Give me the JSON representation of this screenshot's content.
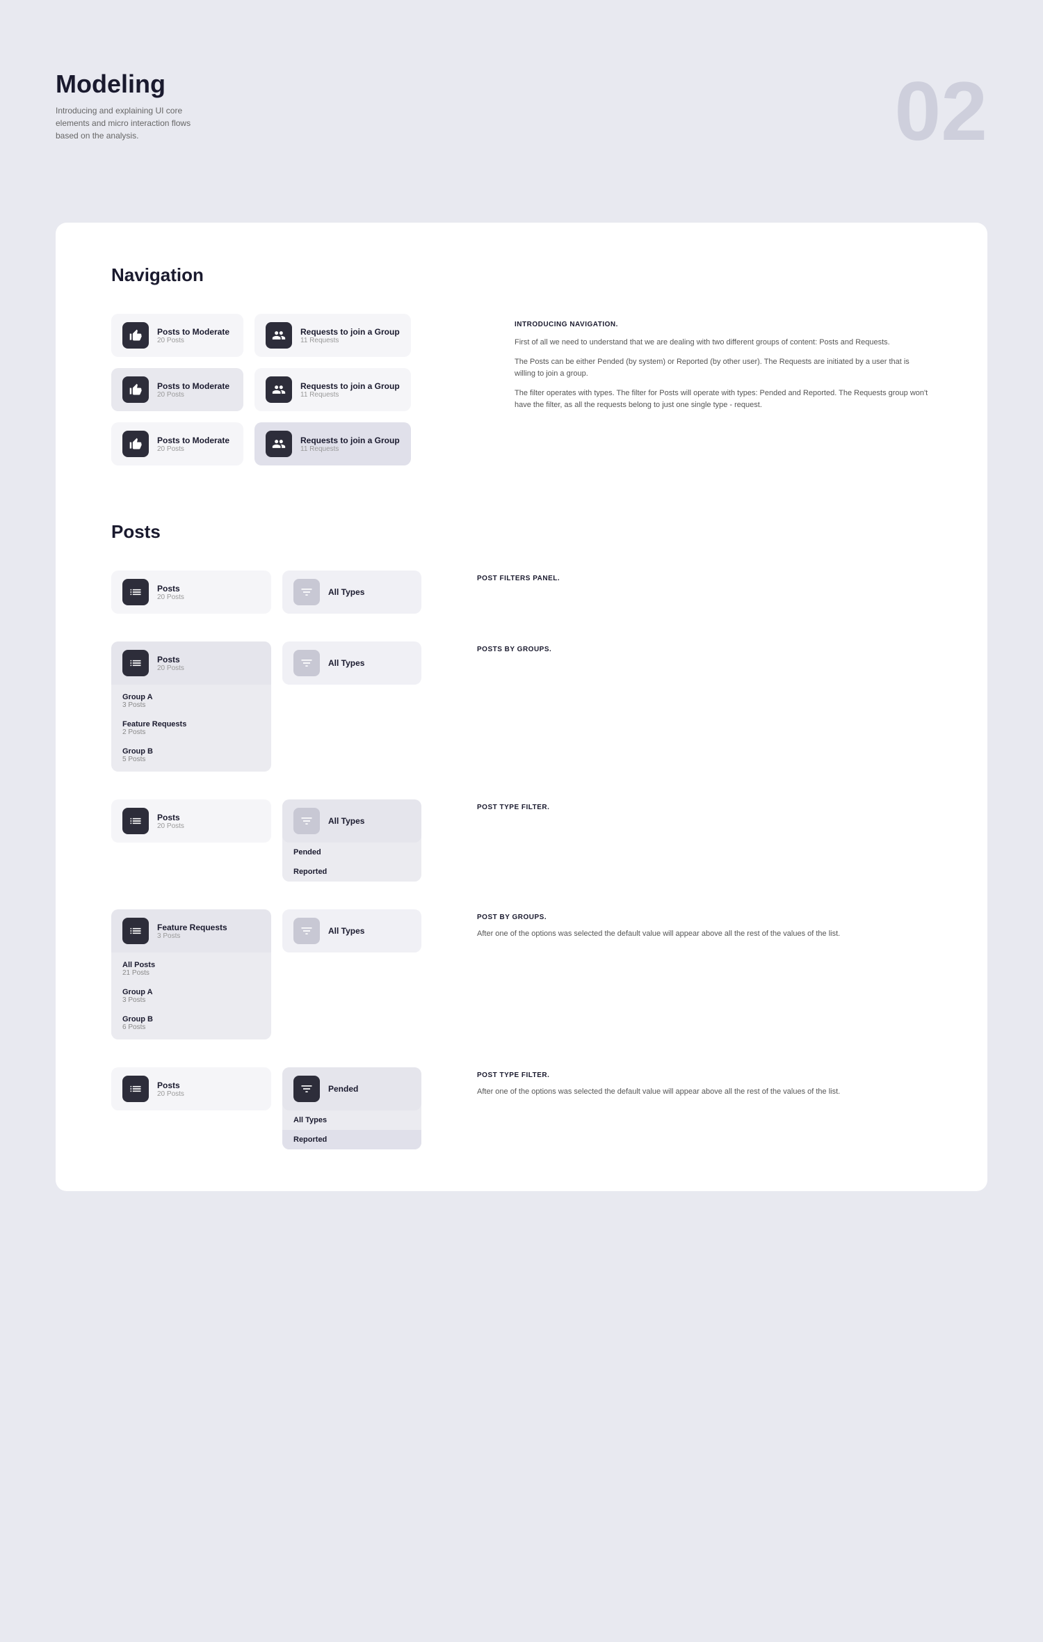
{
  "page": {
    "background_number": "02",
    "title": "Modeling",
    "subtitle": "Introducing and explaining UI core elements and micro interaction flows based on the analysis."
  },
  "navigation_section": {
    "title": "Navigation",
    "description_heading": "INTRODUCING NAVIGATION.",
    "description_paragraphs": [
      "First of all we need to understand that we are dealing with two different groups of content: Posts and Requests.",
      "The Posts can be either Pended (by system) or Reported (by other user). The Requests are initiated by a user that is willing to join a group.",
      "The filter operates with types. The filter for Posts will operate with types: Pended and Reported. The Requests group won't have the filter, as all the requests belong to just one single type - request."
    ],
    "rows": [
      {
        "left": {
          "title": "Posts to Moderate",
          "subtitle": "20 Posts"
        },
        "right": {
          "title": "Requests to join a Group",
          "subtitle": "11 Requests"
        }
      },
      {
        "left": {
          "title": "Posts to Moderate",
          "subtitle": "20 Posts",
          "active": true
        },
        "right": {
          "title": "Requests to join a Group",
          "subtitle": "11 Requests"
        }
      },
      {
        "left": {
          "title": "Posts to Moderate",
          "subtitle": "20 Posts"
        },
        "right": {
          "title": "Requests to join a Group",
          "subtitle": "11 Requests",
          "highlighted": true
        }
      }
    ]
  },
  "posts_section": {
    "title": "Posts",
    "rows": [
      {
        "id": "row1",
        "left_title": "Posts",
        "left_subtitle": "20 Posts",
        "right_label": "All Types",
        "desc_heading": "POST FILTERS PANEL.",
        "desc_text": ""
      },
      {
        "id": "row2",
        "left_title": "Posts",
        "left_subtitle": "20 Posts",
        "left_expanded": true,
        "left_items": [
          {
            "label": "Group A",
            "count": "3 Posts"
          },
          {
            "label": "Feature Requests",
            "count": "2 Posts"
          },
          {
            "label": "Group B",
            "count": "5 Posts"
          }
        ],
        "right_label": "All Types",
        "desc_heading": "POSTS BY GROUPS.",
        "desc_text": ""
      },
      {
        "id": "row3",
        "left_title": "Posts",
        "left_subtitle": "20 Posts",
        "right_label": "All Types",
        "right_expanded": true,
        "right_items": [
          {
            "label": "Pended"
          },
          {
            "label": "Reported"
          }
        ],
        "desc_heading": "POST TYPE FILTER.",
        "desc_text": ""
      },
      {
        "id": "row4",
        "left_title": "Feature Requests",
        "left_subtitle": "3 Posts",
        "left_expanded": true,
        "left_items": [
          {
            "label": "All Posts",
            "count": "21 Posts"
          },
          {
            "label": "Group A",
            "count": "3 Posts"
          },
          {
            "label": "Group B",
            "count": "6 Posts"
          }
        ],
        "right_label": "All Types",
        "desc_heading": "POST BY GROUPS.",
        "desc_text": "After one of the options was selected the default value will appear above all the rest of the values of the list."
      },
      {
        "id": "row5",
        "left_title": "Posts",
        "left_subtitle": "20 Posts",
        "right_label": "Pended",
        "right_expanded": true,
        "right_items": [
          {
            "label": "All Types"
          },
          {
            "label": "Reported"
          }
        ],
        "desc_heading": "POST TYPE FILTER.",
        "desc_text": "After one of the options was selected the default value will appear above all the rest of the values of the list."
      }
    ]
  }
}
